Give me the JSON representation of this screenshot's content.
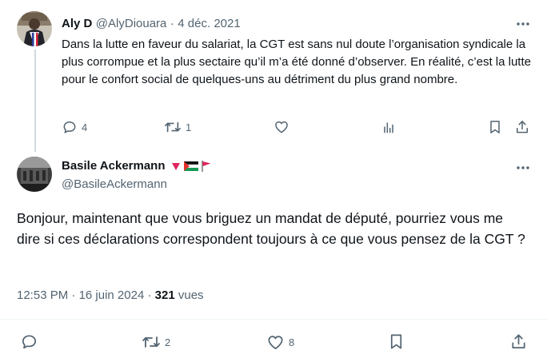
{
  "parent_tweet": {
    "author_name": "Aly D",
    "author_handle": "@AlyDiouara",
    "separator": "·",
    "date": "4 déc. 2021",
    "text": "Dans la lutte en faveur du salariat, la CGT est sans nul doute l’organisation syndicale la plus corrompue et la plus sectaire qu’il m’a été donné d’observer. En réalité, c’est la lutte pour le confort social de quelques-uns au détriment du plus grand nombre.",
    "reply_count": "4",
    "retweet_count": "1",
    "like_count": "",
    "more_icon": "more-dots-icon"
  },
  "main_tweet": {
    "author_name": "Basile Ackermann",
    "author_handle": "@BasileAckermann",
    "emoji": [
      "red-triangle",
      "palestine-flag",
      "red-flag"
    ],
    "text": "Bonjour, maintenant que vous briguez un mandat de député, pourriez vous me dire si ces déclarations correspondent toujours à ce que vous pensez de la CGT ?",
    "time": "12:53 PM",
    "separator_1": "·",
    "date": "16 juin 2024",
    "separator_2": "·",
    "views_count": "321",
    "views_label": "vues",
    "retweet_count": "2",
    "like_count": "8"
  },
  "colors": {
    "text": "#0f1419",
    "muted": "#536471",
    "separator": "#eff3f4",
    "thread_line": "#cfd9de",
    "emoji_red": "#e0245e"
  }
}
